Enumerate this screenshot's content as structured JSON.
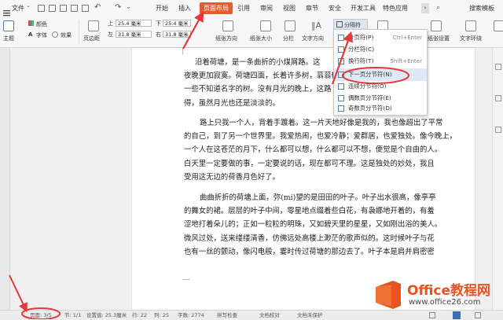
{
  "menubar": {
    "file_label": "文件",
    "tabs": [
      "开始",
      "插入",
      "页面布局",
      "引用",
      "审阅",
      "视图",
      "章节",
      "安全",
      "开发工具",
      "特色应用"
    ],
    "active_tab": "页面布局",
    "search_label": "搜索模板"
  },
  "ribbon": {
    "theme_label": "主题",
    "color_label": "颜色",
    "font_label": "字体",
    "effect_label": "效果",
    "margin_label": "页边距",
    "top_label": "上",
    "top_value": "25.4 毫米",
    "bottom_label": "下",
    "bottom_value": "25.4 毫米",
    "left_label": "左",
    "left_value": "31.8 毫米",
    "right_label": "右",
    "right_value": "31.8 毫米",
    "paper_orientation_label": "纸张方向",
    "paper_size_label": "纸张大小",
    "columns_label": "分栏",
    "text_direction_label": "文字方向",
    "breaks_button_label": "分隔符",
    "paper_settings_label": "纸张设置",
    "text_wrap_label": "文字环绕"
  },
  "dropdown": {
    "items": [
      {
        "label": "分页符(P)",
        "shortcut": "Ctrl+Enter"
      },
      {
        "label": "分栏符(C)",
        "shortcut": ""
      },
      {
        "label": "换行符(T)",
        "shortcut": "Shift+Enter"
      },
      {
        "label": "下一页分节符(N)",
        "shortcut": ""
      },
      {
        "label": "连续分节符(O)",
        "shortcut": ""
      },
      {
        "label": "偶数页分节符(E)",
        "shortcut": ""
      },
      {
        "label": "奇数页分节符(D)",
        "shortcut": ""
      }
    ],
    "highlighted_index": 3
  },
  "document": {
    "paragraphs": [
      [
        "沿着荷塘，是一条曲折的小煤屑路。这",
        "夜晚更加寂寞。荷塘四面，长着许多树，蓊蓊郁郁",
        "一些不知道名字的树。没有月光的晚上，这路",
        "得，虽然月光也还是淡淡的。"
      ],
      [
        "路上只我一个人，背着手踱着。这一片天地好像是我的，我也像超出了平常",
        "的自己，到了另一个世界里。我爱热闹，也爱冷静；爱群居，也爱独处。像今晚上，",
        "一个人在这苍茫的月下，什么都可以想，什么都可以不想，便觉是个自由的人。",
        "白天里一定要做的事，一定要说的话，现在都可不理。这是独处的妙处，我且",
        "受用这无边的荷香月色好了。"
      ],
      [
        "曲曲折折的荷塘上面，弥(mi)望的是田田的叶子。叶子出水很高，像亭亭",
        "的舞女的裙。层层的叶子中间，零星地点缀着些白花，有袅娜地开着的，有羞",
        "涩地打着朵儿的；正如一粒粒的明珠，又如碧天里的星星，又如刚出浴的美人。",
        "微风过处，送来缕缕清香，仿佛远处高楼上渺茫的歌声似的。这时候叶子与花",
        "也有一丝的颤动，像闪电般，霎时传过荷塘的那边去了。叶子本是肩并肩密密"
      ]
    ]
  },
  "statusbar": {
    "page": "页面: 3/5",
    "section": "节: 1/1",
    "setting": "设置值: 25.3厘米",
    "row": "行: 22",
    "col": "列: 25",
    "words": "字数: 2774",
    "spell": "拼写检查",
    "doc_check": "文档校对",
    "protect": "文档未保护"
  },
  "watermark": {
    "brand": "Office教程网",
    "url": "www.office26.com"
  },
  "colors": {
    "accent": "#e85a2c",
    "annotation": "#e23a3a"
  }
}
